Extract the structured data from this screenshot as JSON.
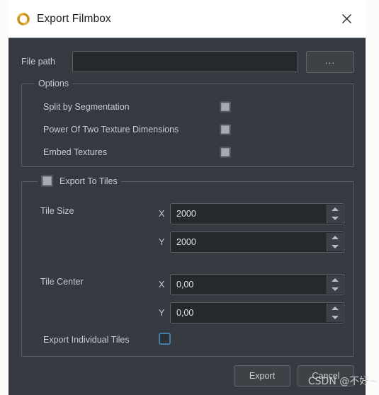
{
  "window": {
    "title": "Export Filmbox",
    "icon": "swirl-icon",
    "close_label": "×",
    "accent_blue": "#3f7fa8",
    "body_bg": "#343a40",
    "titlebar_bg": "#ffffff",
    "text_color": "#c9ccd0",
    "icon_color": "#d4a017"
  },
  "filepath": {
    "label": "File path",
    "value": "",
    "placeholder": "",
    "browse_label": "..."
  },
  "options": {
    "title": "Options",
    "items": [
      {
        "label": "Split by Segmentation",
        "checked": "partial"
      },
      {
        "label": "Power Of Two Texture Dimensions",
        "checked": "partial"
      },
      {
        "label": "Embed Textures",
        "checked": "partial"
      }
    ]
  },
  "tiles": {
    "title": "Export To Tiles",
    "enabled": "partial",
    "tile_size": {
      "label": "Tile Size",
      "x_label": "X",
      "x_value": "2000",
      "y_label": "Y",
      "y_value": "2000"
    },
    "tile_center": {
      "label": "Tile Center",
      "x_label": "X",
      "x_value": "0,00",
      "y_label": "Y",
      "y_value": "0,00"
    },
    "export_individual": {
      "label": "Export Individual Tiles",
      "checked": "false"
    }
  },
  "footer": {
    "export_label": "Export",
    "cancel_label": "Cancel"
  },
  "watermark": {
    "text": "CSDN @不好~"
  }
}
